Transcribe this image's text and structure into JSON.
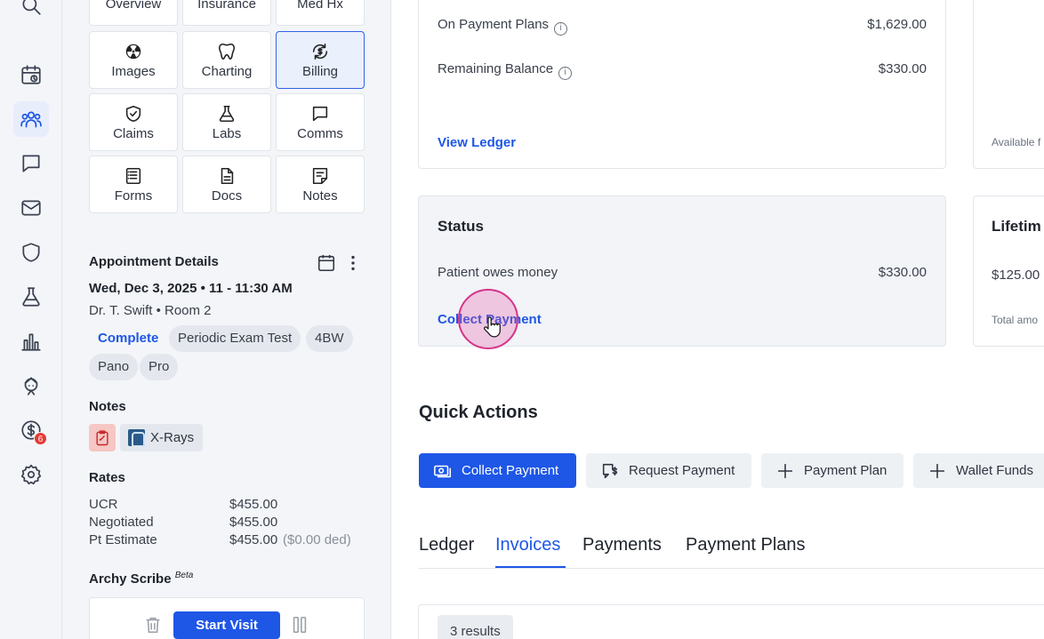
{
  "rail": {
    "icons": [
      "search-icon",
      "calendar-icon",
      "patients-icon",
      "chat-icon",
      "mail-icon",
      "shield-icon",
      "flask-icon",
      "chart-icon",
      "doctor-icon",
      "dollar-icon",
      "gear-icon"
    ],
    "dollar_badge": "6"
  },
  "sidebar": {
    "tiles": {
      "overview": "Overview",
      "insurance": "Insurance",
      "medhx": "Med Hx",
      "images": "Images",
      "charting": "Charting",
      "billing": "Billing",
      "claims": "Claims",
      "labs": "Labs",
      "comms": "Comms",
      "forms": "Forms",
      "docs": "Docs",
      "notes": "Notes"
    },
    "appointment": {
      "title": "Appointment Details",
      "datetime": "Wed, Dec 3, 2025 • 11 - 11:30 AM",
      "provider": "Dr. T. Swift • Room 2",
      "tags": [
        "Complete",
        "Periodic Exam Test",
        "4BW",
        "Pano",
        "Pro"
      ]
    },
    "notes": {
      "title": "Notes",
      "xray": "X-Rays"
    },
    "rates": {
      "title": "Rates",
      "rows": [
        {
          "label": "UCR",
          "value": "$455.00",
          "extra": ""
        },
        {
          "label": "Negotiated",
          "value": "$455.00",
          "extra": ""
        },
        {
          "label": "Pt Estimate",
          "value": "$455.00",
          "extra": "($0.00 ded)"
        }
      ]
    },
    "scribe": {
      "title": "Archy Scribe",
      "beta": "Beta",
      "start": "Start Visit"
    }
  },
  "main": {
    "balance_card": {
      "on_payment_plans_label": "On Payment Plans",
      "on_payment_plans_value": "$1,629.00",
      "remaining_label": "Remaining Balance",
      "remaining_value": "$330.00",
      "view_ledger": "View Ledger"
    },
    "right_card_top": {
      "text": "Available f"
    },
    "status_card": {
      "title": "Status",
      "label": "Patient owes money",
      "value": "$330.00",
      "action": "Collect Payment"
    },
    "lifetime_card": {
      "title": "Lifetim",
      "value": "$125.00",
      "caption": "Total amo"
    },
    "quick_actions": {
      "title": "Quick Actions",
      "buttons": [
        "Collect Payment",
        "Request Payment",
        "Payment Plan",
        "Wallet Funds"
      ]
    },
    "tabs": [
      "Ledger",
      "Invoices",
      "Payments",
      "Payment Plans"
    ],
    "active_tab": "Invoices",
    "results": "3 results"
  },
  "colors": {
    "accent": "#1e56e6",
    "cursor": "#d6338a"
  }
}
